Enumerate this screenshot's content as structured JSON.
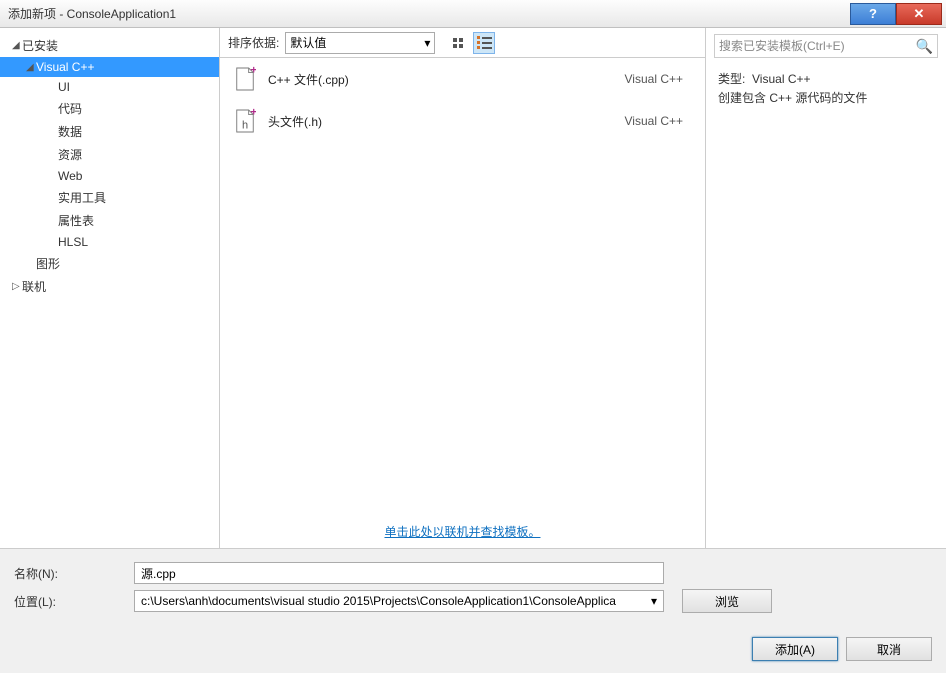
{
  "window": {
    "title": "添加新项 - ConsoleApplication1"
  },
  "sidebar": {
    "installed": "已安装",
    "vcpp": "Visual C++",
    "items": [
      "UI",
      "代码",
      "数据",
      "资源",
      "Web",
      "实用工具",
      "属性表",
      "HLSL"
    ],
    "graphics": "图形",
    "online": "联机"
  },
  "toolbar": {
    "sort_label": "排序依据:",
    "sort_value": "默认值"
  },
  "templates": [
    {
      "name": "C++ 文件(.cpp)",
      "lang": "Visual C++",
      "icon": "cpp"
    },
    {
      "name": "头文件(.h)",
      "lang": "Visual C++",
      "icon": "h"
    }
  ],
  "online_link": "单击此处以联机并查找模板。",
  "search": {
    "placeholder": "搜索已安装模板(Ctrl+E)"
  },
  "detail": {
    "type_label": "类型:",
    "type_value": "Visual C++",
    "description": "创建包含 C++ 源代码的文件"
  },
  "fields": {
    "name_label": "名称(N):",
    "name_value": "源.cpp",
    "location_label": "位置(L):",
    "location_value": "c:\\Users\\anh\\documents\\visual studio 2015\\Projects\\ConsoleApplication1\\ConsoleApplica",
    "browse": "浏览"
  },
  "footer": {
    "add": "添加(A)",
    "cancel": "取消"
  }
}
